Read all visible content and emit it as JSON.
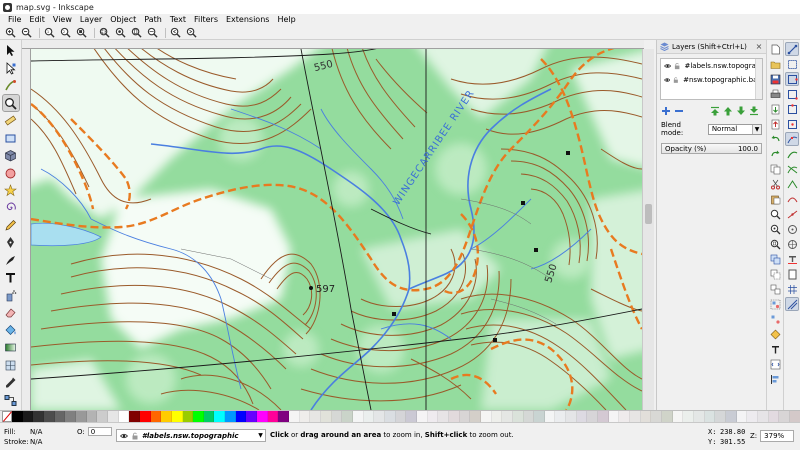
{
  "window": {
    "title": "map.svg - Inkscape"
  },
  "menu": [
    "File",
    "Edit",
    "View",
    "Layer",
    "Object",
    "Path",
    "Text",
    "Filters",
    "Extensions",
    "Help"
  ],
  "map": {
    "contour_label_a": "550",
    "contour_label_b": "550",
    "spot_height": "597",
    "river_label": "WINGECARRIBEE    RIVER"
  },
  "layers_panel": {
    "title": "Layers (Shift+Ctrl+L)",
    "layers": [
      {
        "name": "#labels.nsw.topographic"
      },
      {
        "name": "#nsw.topographic.basemap"
      }
    ],
    "blend_label": "Blend mode:",
    "blend_value": "Normal",
    "opacity_label": "Opacity (%)",
    "opacity_value": "100.0"
  },
  "status": {
    "fill_label": "Fill:",
    "fill_value": "N/A",
    "stroke_label": "Stroke:",
    "stroke_value": "N/A",
    "opacity_prefix": "O:",
    "opacity_value": "0",
    "current_layer": "#labels.nsw.topographic",
    "msg_click": "Click",
    "msg_mid": " or ",
    "msg_drag": "drag around an area",
    "msg_mid2": " to zoom in, ",
    "msg_shift": "Shift+click",
    "msg_end": " to zoom out.",
    "x_label": "X:",
    "x_value": "238.80",
    "y_label": "Y:",
    "y_value": "301.55",
    "zoom_label": "Z:",
    "zoom_value": "379%"
  },
  "colors": {
    "map_green": "#8fd99a",
    "contour": "#9a5a2a",
    "track": "#e87a20",
    "water": "#4a7fe0"
  }
}
